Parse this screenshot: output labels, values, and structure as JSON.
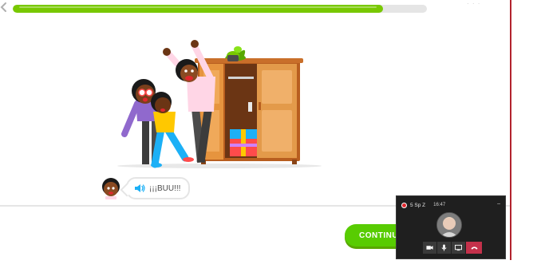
{
  "lesson": {
    "back_icon": "chevron-left-icon",
    "progress_fraction": 0.894,
    "colors": {
      "progress_fill": "#78c800",
      "progress_track": "#e5e5e5",
      "continue": "#58cc02"
    }
  },
  "dialogue": {
    "speaker_icon": "speaker-icon",
    "text": "¡¡¡BUU!!!"
  },
  "footer": {
    "continue_label": "CONTINUE"
  },
  "call": {
    "title": "5 Sp Z",
    "time": "16:47",
    "minimize_label": "–",
    "controls": [
      "video-icon",
      "microphone-icon",
      "share-screen-icon",
      "hang-up-icon"
    ],
    "accent": "#c4314b"
  }
}
